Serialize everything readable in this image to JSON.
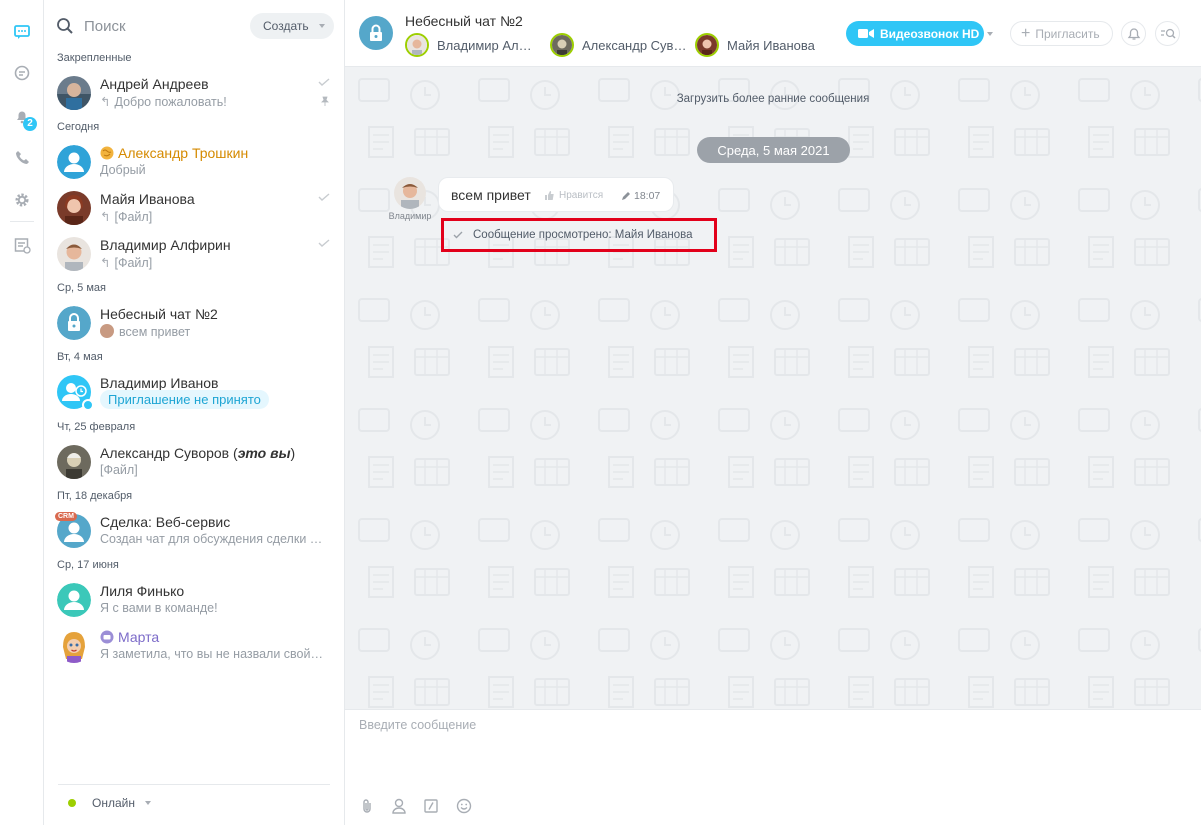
{
  "rail": {
    "items": [
      {
        "icon": "chat-bubble-icon",
        "active": true
      },
      {
        "icon": "open-lines-icon"
      },
      {
        "icon": "bell-icon",
        "badge": "2"
      },
      {
        "icon": "phone-icon"
      },
      {
        "icon": "gear-icon"
      },
      {
        "icon": "tasks-list-icon"
      }
    ]
  },
  "sidebar": {
    "search_placeholder": "Поиск",
    "create_label": "Создать",
    "sections": {
      "pinned": "Закрепленные",
      "today": "Сегодня",
      "may5": "Ср, 5 мая",
      "may4": "Вт, 4 мая",
      "feb25": "Чт, 25 февраля",
      "dec18": "Пт, 18 декабря",
      "jun17": "Ср, 17 июня"
    },
    "chats": {
      "andreev": {
        "name": "Андрей Андреев",
        "preview": "Добро пожаловать!"
      },
      "troshkin": {
        "name": "Александр Трошкин",
        "preview": "Добрый"
      },
      "ivanova": {
        "name": "Майя Иванова",
        "preview": "[Файл]"
      },
      "alfirin": {
        "name": "Владимир Алфирин",
        "preview": "[Файл]"
      },
      "sky": {
        "name": "Небесный чат №2",
        "preview": "всем привет"
      },
      "ivanov": {
        "name": "Владимир Иванов",
        "preview": "Приглашение не принято"
      },
      "suvorov": {
        "name": "Александр Суворов (",
        "name_suffix": "это вы",
        "name_close": ")",
        "preview": "[Файл]"
      },
      "deal": {
        "name": "Сделка: Веб-сервис",
        "badge": "CRM",
        "preview": "Создан чат для обсуждения сделки …"
      },
      "finko": {
        "name": "Лиля Финько",
        "preview": "Я с вами в команде!"
      },
      "marta": {
        "name": "Марта",
        "preview": "Я заметила, что вы не назвали свой…"
      }
    },
    "status_label": "Онлайн"
  },
  "chat": {
    "title": "Небесный чат №2",
    "members": [
      "Владимир Ал…",
      "Александр Сув…",
      "Майя Иванова"
    ],
    "video_label": "Видеозвонок HD",
    "invite_label": "Пригласить",
    "load_earlier": "Загрузить более ранние сообщения",
    "date_divider": "Среда, 5 мая 2021",
    "message": {
      "author": "Владимир",
      "text": "всем привет",
      "like_label": "Нравится",
      "time": "18:07"
    },
    "read_receipt": "Сообщение просмотрено: Майя Иванова",
    "composer_placeholder": "Введите сообщение"
  },
  "colors": {
    "accent": "#2fc6f6",
    "online": "#9dcf00",
    "highlight": "#e2001a",
    "troshkin_name": "#d58a00",
    "marta_name": "#7c6bc9"
  }
}
